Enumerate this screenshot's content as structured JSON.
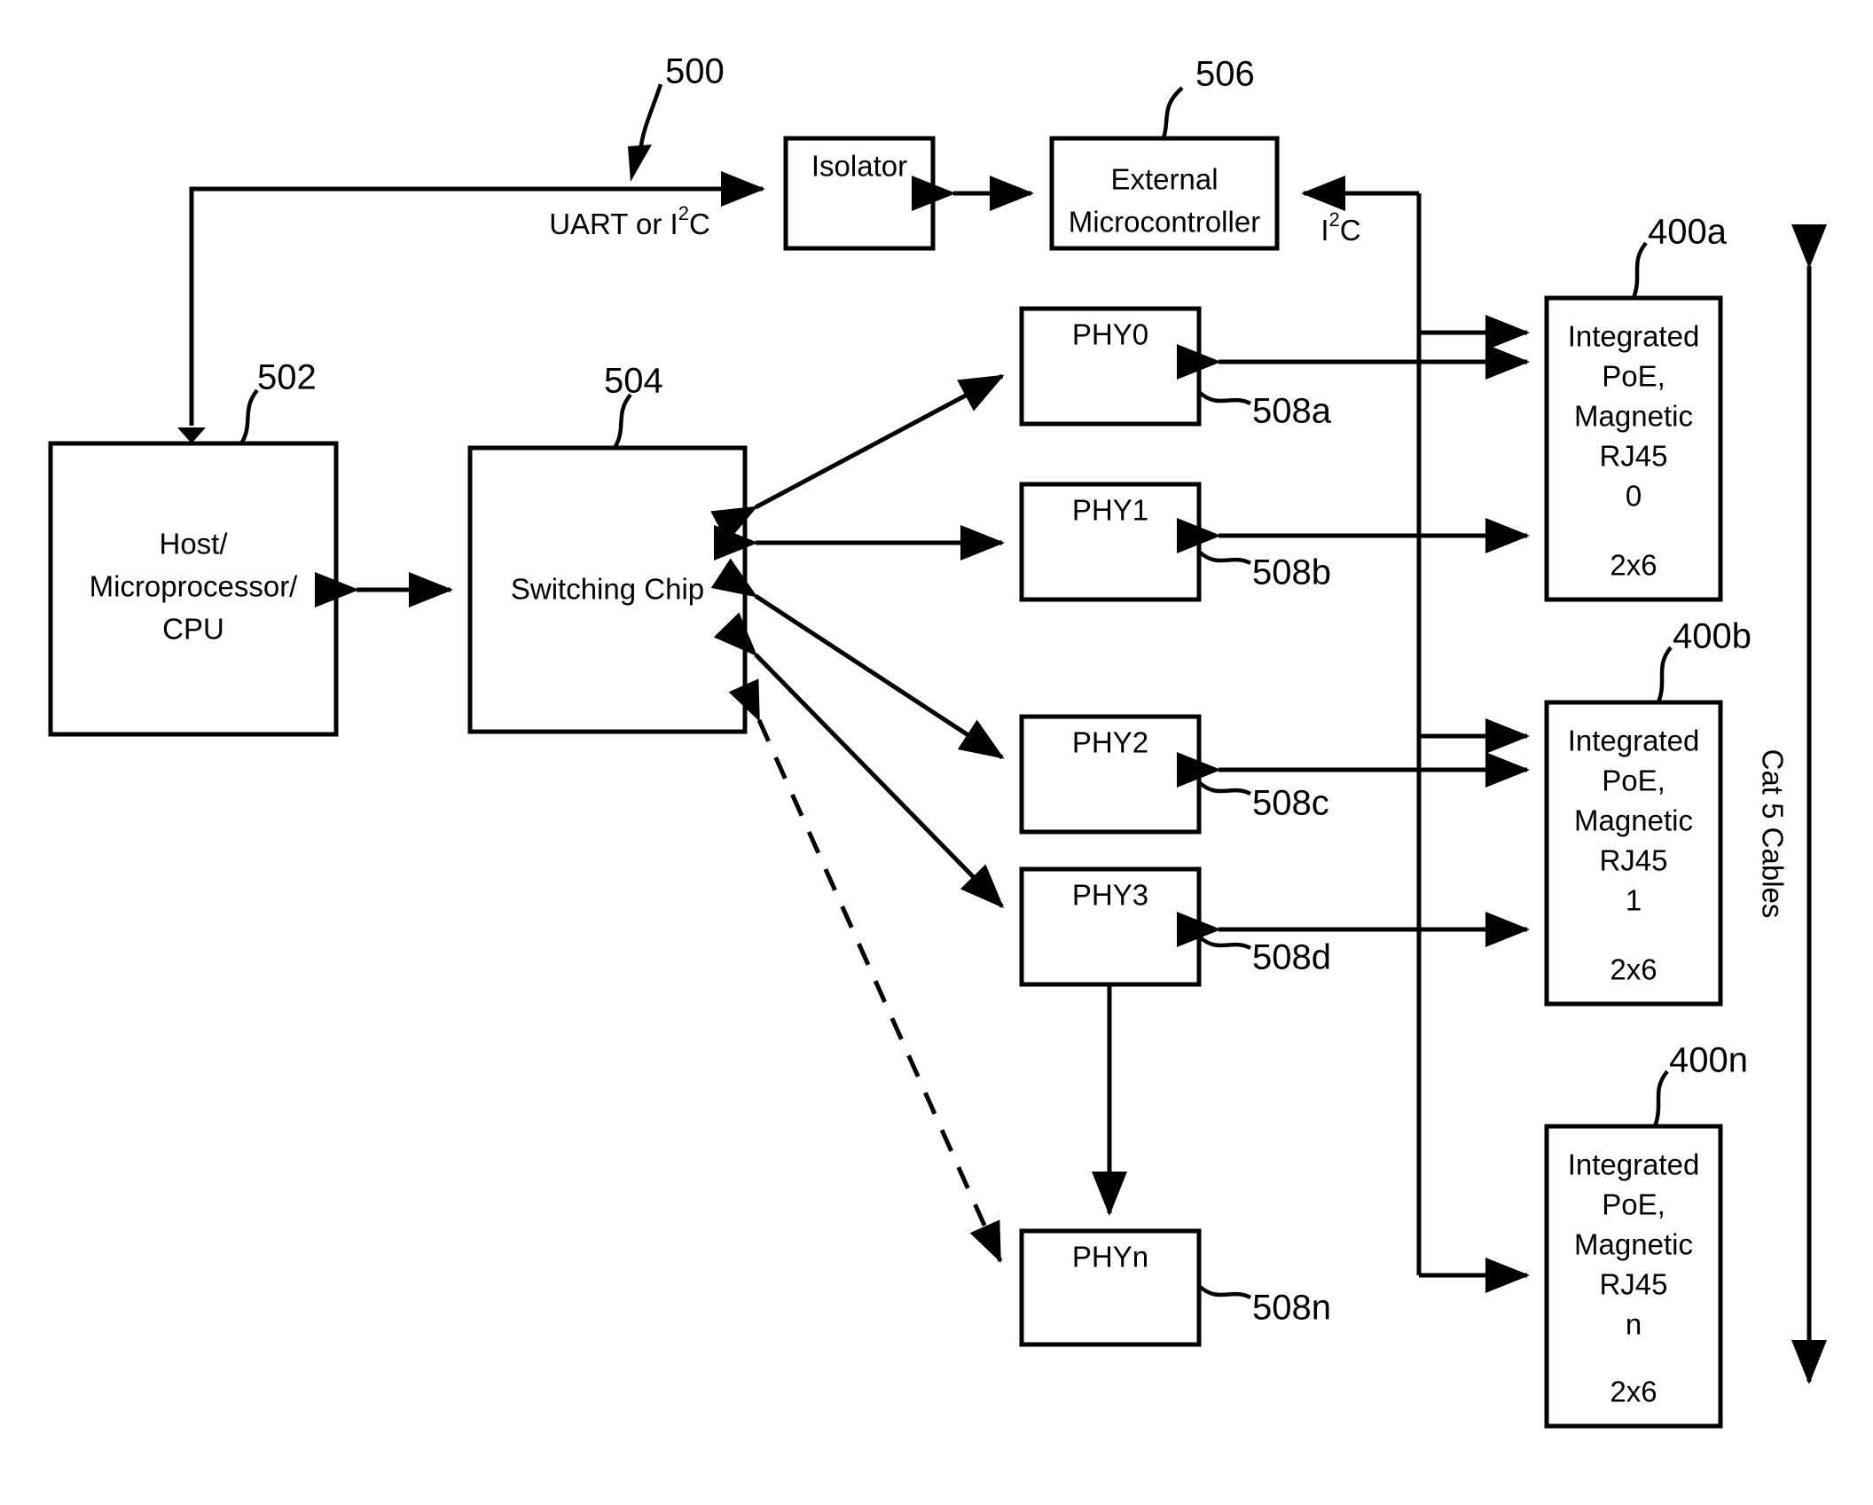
{
  "figure": {
    "ref_main": "500",
    "nodes": {
      "isolator": {
        "label": "Isolator"
      },
      "ext_mcu": {
        "line1": "External",
        "line2": "Microcontroller",
        "ref": "506"
      },
      "host": {
        "line1": "Host/",
        "line2": "Microprocessor/",
        "line3": "CPU",
        "ref": "502"
      },
      "switch": {
        "label": "Switching Chip",
        "ref": "504"
      },
      "phy0": {
        "label": "PHY0",
        "ref": "508a"
      },
      "phy1": {
        "label": "PHY1",
        "ref": "508b"
      },
      "phy2": {
        "label": "PHY2",
        "ref": "508c"
      },
      "phy3": {
        "label": "PHY3",
        "ref": "508d"
      },
      "phyn": {
        "label": "PHYn",
        "ref": "508n"
      },
      "poe_a": {
        "line1": "Integrated",
        "line2": "PoE,",
        "line3": "Magnetic",
        "line4": "RJ45",
        "line5": "0",
        "line6": "2x6",
        "ref": "400a"
      },
      "poe_b": {
        "line1": "Integrated",
        "line2": "PoE,",
        "line3": "Magnetic",
        "line4": "RJ45",
        "line5": "1",
        "line6": "2x6",
        "ref": "400b"
      },
      "poe_n": {
        "line1": "Integrated",
        "line2": "PoE,",
        "line3": "Magnetic",
        "line4": "RJ45",
        "line5": "n",
        "line6": "2x6",
        "ref": "400n"
      }
    },
    "signals": {
      "uart_i2c_pre": "UART or I",
      "uart_i2c_sup": "2",
      "uart_i2c_post": "C",
      "i2c_pre": "I",
      "i2c_sup": "2",
      "i2c_post": "C",
      "cat5": "Cat 5 Cables"
    }
  }
}
